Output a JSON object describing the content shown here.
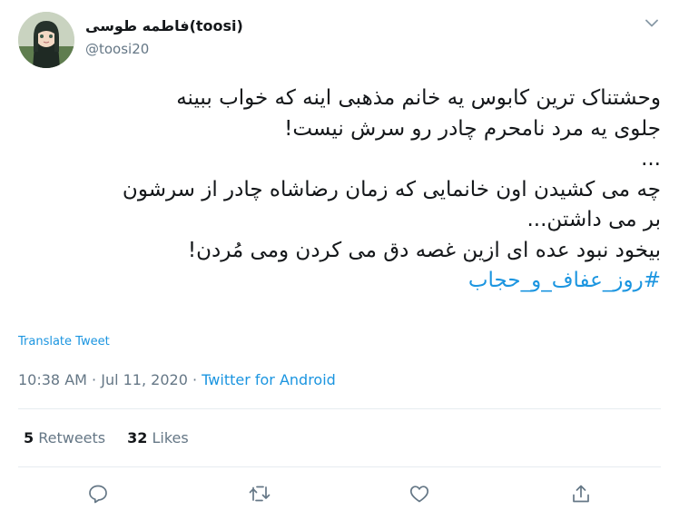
{
  "author": {
    "display_name": "فاطمه طوسی(toosi)",
    "handle": "@toosi20",
    "avatar_icon": "avatar-illustration"
  },
  "tweet": {
    "lines": [
      "وحشتناک ترین کابوس یه خانم مذهبی اینه که خواب ببینه",
      "جلوی یه مرد نامحرم چادر رو سرش نیست!",
      "...",
      "چه می کشیدن اون خانمایی که زمان رضاشاه چادر از سرشون",
      "بر می داشتن...",
      "بیخود نبود عده ای ازین غصه دق می کردن ومی مُردن!"
    ],
    "hashtag": "#روز_عفاف_و_حجاب"
  },
  "translate_label": "Translate Tweet",
  "timestamp": {
    "time": "10:38 AM",
    "separator": "·",
    "date": "Jul 11, 2020",
    "source": "Twitter for Android"
  },
  "stats": {
    "retweets_count": "5",
    "retweets_label": "Retweets",
    "likes_count": "32",
    "likes_label": "Likes"
  },
  "actions": [
    "reply-icon",
    "retweet-icon",
    "like-icon",
    "share-icon"
  ],
  "colors": {
    "link": "#1b95e0",
    "muted": "#657786",
    "text": "#14171a",
    "divider": "#e6ecf0"
  }
}
